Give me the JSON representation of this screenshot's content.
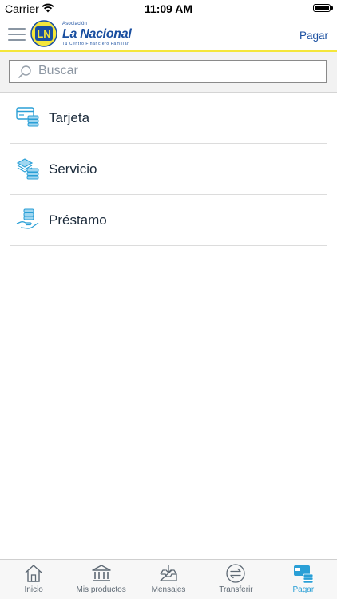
{
  "status_bar": {
    "carrier": "Carrier",
    "time": "11:09 AM"
  },
  "header": {
    "logo_text_small": "Asociación",
    "logo_text_main": "La Nacional",
    "logo_tagline": "Tu Centro Financiero Familiar",
    "logo_mark": "LN",
    "action_label": "Pagar"
  },
  "search": {
    "placeholder": "Buscar",
    "value": ""
  },
  "items": [
    {
      "label": "Tarjeta",
      "icon": "card-coins-icon"
    },
    {
      "label": "Servicio",
      "icon": "cash-stack-icon"
    },
    {
      "label": "Préstamo",
      "icon": "hand-coins-icon"
    }
  ],
  "tabs": [
    {
      "label": "Inicio",
      "icon": "home-icon",
      "active": false
    },
    {
      "label": "Mis productos",
      "icon": "bank-icon",
      "active": false
    },
    {
      "label": "Mensajes",
      "icon": "inbox-icon",
      "active": false
    },
    {
      "label": "Transferir",
      "icon": "transfer-icon",
      "active": false
    },
    {
      "label": "Pagar",
      "icon": "pay-icon",
      "active": true
    }
  ],
  "colors": {
    "brand_blue": "#1a4fa0",
    "accent_yellow": "#f4e63a",
    "icon_cyan": "#2a9fd6",
    "tab_inactive": "#5d6873"
  }
}
